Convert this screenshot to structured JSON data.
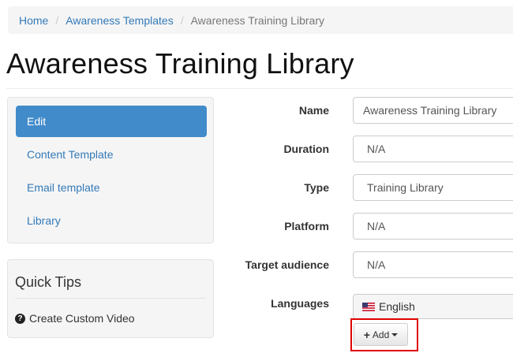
{
  "breadcrumb": {
    "items": [
      "Home",
      "Awareness Templates"
    ],
    "current": "Awareness Training Library",
    "separator": "/"
  },
  "page": {
    "title": "Awareness Training Library"
  },
  "sidebar": {
    "items": [
      {
        "label": "Edit",
        "active": true
      },
      {
        "label": "Content Template",
        "active": false
      },
      {
        "label": "Email template",
        "active": false
      },
      {
        "label": "Library",
        "active": false
      }
    ]
  },
  "tips": {
    "title": "Quick Tips",
    "link_label": "Create Custom Video",
    "icon": "question-circle-icon"
  },
  "form": {
    "name_label": "Name",
    "name_value": "Awareness Training Library",
    "duration_label": "Duration",
    "duration_value": "N/A",
    "type_label": "Type",
    "type_value": "Training Library",
    "platform_label": "Platform",
    "platform_value": "N/A",
    "audience_label": "Target audience",
    "audience_value": "N/A",
    "languages_label": "Languages",
    "language_value": "English",
    "language_flag": "us-flag-icon",
    "add_label": "Add"
  },
  "colors": {
    "link": "#337ab7",
    "active_nav": "#428bca",
    "highlight": "#e00000"
  }
}
